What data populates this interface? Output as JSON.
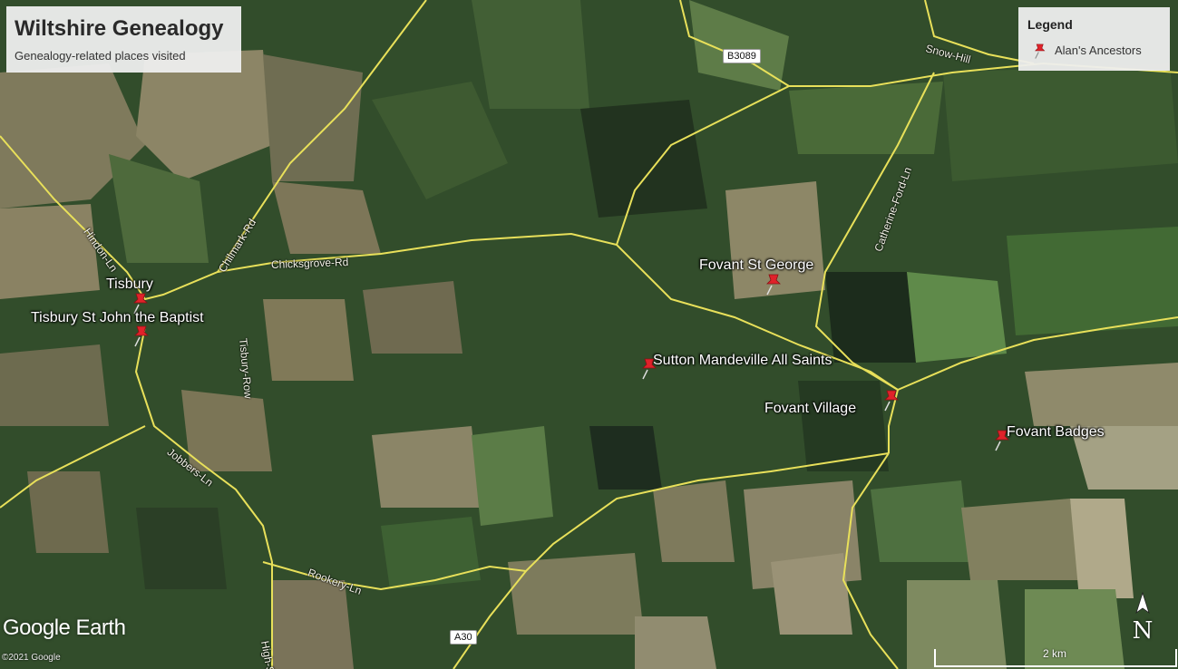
{
  "title_box": {
    "title": "Wiltshire Genealogy",
    "subtitle": "Genealogy-related places visited"
  },
  "legend": {
    "title": "Legend",
    "items": [
      {
        "label": "Alan's Ancestors",
        "icon": "red-pushpin-icon",
        "color": "#e0222a"
      }
    ]
  },
  "places": [
    {
      "name": "Tisbury",
      "icon": "red-pushpin-icon"
    },
    {
      "name": "Tisbury St John the Baptist",
      "icon": "red-pushpin-icon"
    },
    {
      "name": "Fovant St George",
      "icon": "red-pushpin-icon"
    },
    {
      "name": "Sutton Mandeville All Saints",
      "icon": "red-pushpin-icon"
    },
    {
      "name": "Fovant Village",
      "icon": "red-pushpin-icon"
    },
    {
      "name": "Fovant Badges",
      "icon": "red-pushpin-icon"
    }
  ],
  "roads": {
    "labels": [
      "Snow-Hill",
      "Hindon-Ln",
      "Chilmark-Rd",
      "Chicksgrove-Rd",
      "Catherine-Ford-Ln",
      "Tisbury-Row",
      "Jobbers-Ln",
      "Rookery-Ln",
      "High-St"
    ],
    "shields": [
      "B3089",
      "A30"
    ],
    "color": "#e8e05a"
  },
  "branding": {
    "logo": "Google Earth",
    "copyright": "©2021 Google"
  },
  "compass": {
    "letter": "N",
    "icon": "north-arrow-icon"
  },
  "scale": {
    "label": "2 km"
  }
}
